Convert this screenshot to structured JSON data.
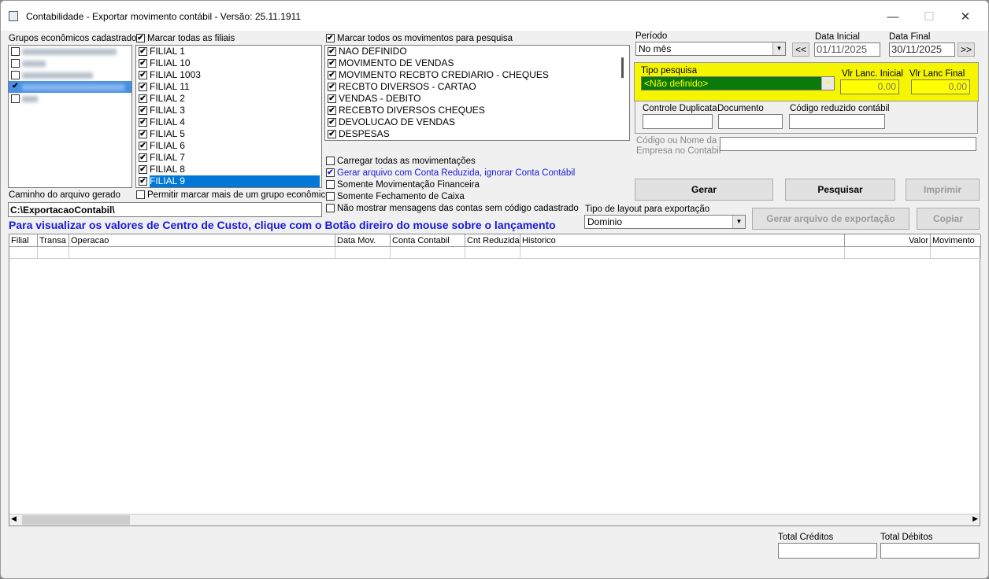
{
  "window": {
    "title": "Contabilidade - Exportar movimento contábil - Versão: 25.11.1911",
    "minimize": "—",
    "maximize": "☐",
    "close": "✕"
  },
  "groups": {
    "label": "Grupos econômicos cadastrados",
    "checked": [
      false,
      false,
      false,
      true,
      false
    ]
  },
  "filiais": {
    "mark_all_label": "Marcar todas as filiais",
    "items": [
      "FILIAL 1",
      "FILIAL 10",
      "FILIAL 1003",
      "FILIAL 11",
      "FILIAL 2",
      "FILIAL 3",
      "FILIAL 4",
      "FILIAL 5",
      "FILIAL 6",
      "FILIAL 7",
      "FILIAL 8",
      "FILIAL 9"
    ],
    "allow_multi_label": "Permitir marcar mais de um grupo econômico"
  },
  "movimentos": {
    "mark_all_label": "Marcar todos os movimentos para pesquisa",
    "items": [
      "NAO DEFINIDO",
      "MOVIMENTO DE VENDAS",
      "MOVIMENTO RECBTO CREDIARIO - CHEQUES",
      "RECBTO DIVERSOS - CARTAO",
      "VENDAS - DEBITO",
      "RECEBTO DIVERSOS CHEQUES",
      "DEVOLUCAO DE VENDAS",
      "DESPESAS"
    ]
  },
  "options": [
    {
      "label": "Carregar todas as movimentações",
      "checked": false
    },
    {
      "label": "Gerar arquivo com Conta Reduzida, ignorar Conta Contábil",
      "checked": true
    },
    {
      "label": "Somente Movimentação Financeira",
      "checked": false
    },
    {
      "label": "Somente Fechamento de Caixa",
      "checked": false
    },
    {
      "label": "Não mostrar mensagens das contas sem código cadastrado",
      "checked": false
    }
  ],
  "path": {
    "label": "Caminho do arquivo gerado",
    "value": "C:\\ExportacaoContabil\\"
  },
  "info_text": "Para visualizar os valores de Centro de Custo, clique com o Botão direiro do mouse sobre o lançamento",
  "periodo": {
    "label": "Período",
    "value": "No mês",
    "prev": "<<",
    "next": ">>",
    "data_inicial_label": "Data Inicial",
    "data_inicial": "01/11/2025",
    "data_final_label": "Data Final",
    "data_final": "30/11/2025"
  },
  "tipo_pesquisa": {
    "label": "Tipo pesquisa",
    "value": "<Não definido>",
    "vlr_inicial_label": "Vlr Lanc. Inicial",
    "vlr_inicial": "0,00",
    "vlr_final_label": "Vlr Lanc Final",
    "vlr_final": "0,00"
  },
  "filtros": {
    "controle_label": "Controle Duplicata",
    "documento_label": "Documento",
    "codigo_label": "Código reduzido contábil",
    "empresa_label_1": "Código ou Nome da",
    "empresa_label_2": "Empresa no Contabil"
  },
  "buttons": {
    "gerar": "Gerar",
    "pesquisar": "Pesquisar",
    "imprimir": "Imprimir",
    "gerar_arquivo": "Gerar arquivo de exportação",
    "copiar": "Copiar"
  },
  "layout": {
    "label": "Tipo de layout para exportação",
    "value": "Dominio"
  },
  "grid": {
    "columns": [
      "Filial",
      "Transa",
      "Operacao",
      "Data  Mov.",
      "Conta Contabil",
      "Cnt Reduzida",
      "Historico",
      "Valor",
      "Movimento"
    ]
  },
  "totals": {
    "creditos_label": "Total Créditos",
    "debitos_label": "Total Débitos"
  }
}
